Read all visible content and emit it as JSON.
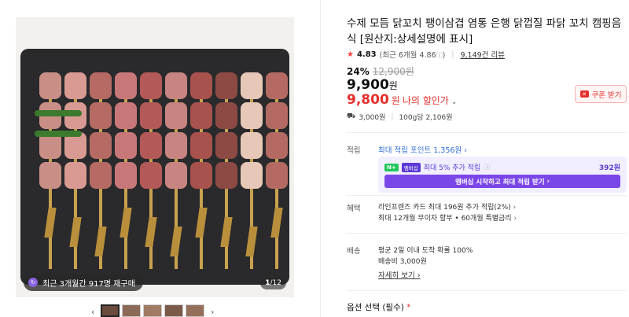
{
  "gallery": {
    "repurchase_badge": "최근 3개월간 917명 재구매",
    "pager_current": "1",
    "pager_total": "/12"
  },
  "product": {
    "title": "수제 모듬 닭꼬치 팽이삼겹 염통 은행 닭껍질 파닭 꼬치 캠핑음식 [원산지:상세설명에 표시]",
    "rating": "4.83",
    "rating_recent": "(최근 6개월 4.86",
    "rating_recent_close": ")",
    "reviews": "9,149건 리뷰",
    "discount_pct": "24%",
    "original_price": "12,900원",
    "price": "9,900",
    "price_unit": "원",
    "my_price": "9,800",
    "my_price_unit": "원",
    "my_price_label": "나의 할인가",
    "coupon_label": "쿠폰 받기",
    "shipping_fee": "3,000원",
    "unit_price": "100g당 2,106원"
  },
  "points": {
    "label": "적립",
    "max_points": "최대 적립 포인트 1,356원",
    "member_text": "최대 5% 추가 적립",
    "member_amount": "392원",
    "nplus": "N+",
    "member_tag": "멤버십",
    "member_button": "멤버십 시작하고 최대 적립 받기"
  },
  "benefits": {
    "label": "혜택",
    "line1": "라인프렌즈 카드 최대 196원 추가 적립(2%)",
    "line2": "최대 12개월 무이자 할부 • 60개월 특별금리"
  },
  "delivery": {
    "label": "배송",
    "line1": "평균 2일 이내 도착 확률 100%",
    "line2": "배송비 3,000원",
    "more": "자세히 보기"
  },
  "option": {
    "label": "옵션 선택 (필수)",
    "required_mark": "*"
  },
  "colors": {
    "sale_red": "#e5302c",
    "link_blue": "#2f6fd6",
    "membership_purple": "#7a46e8"
  }
}
